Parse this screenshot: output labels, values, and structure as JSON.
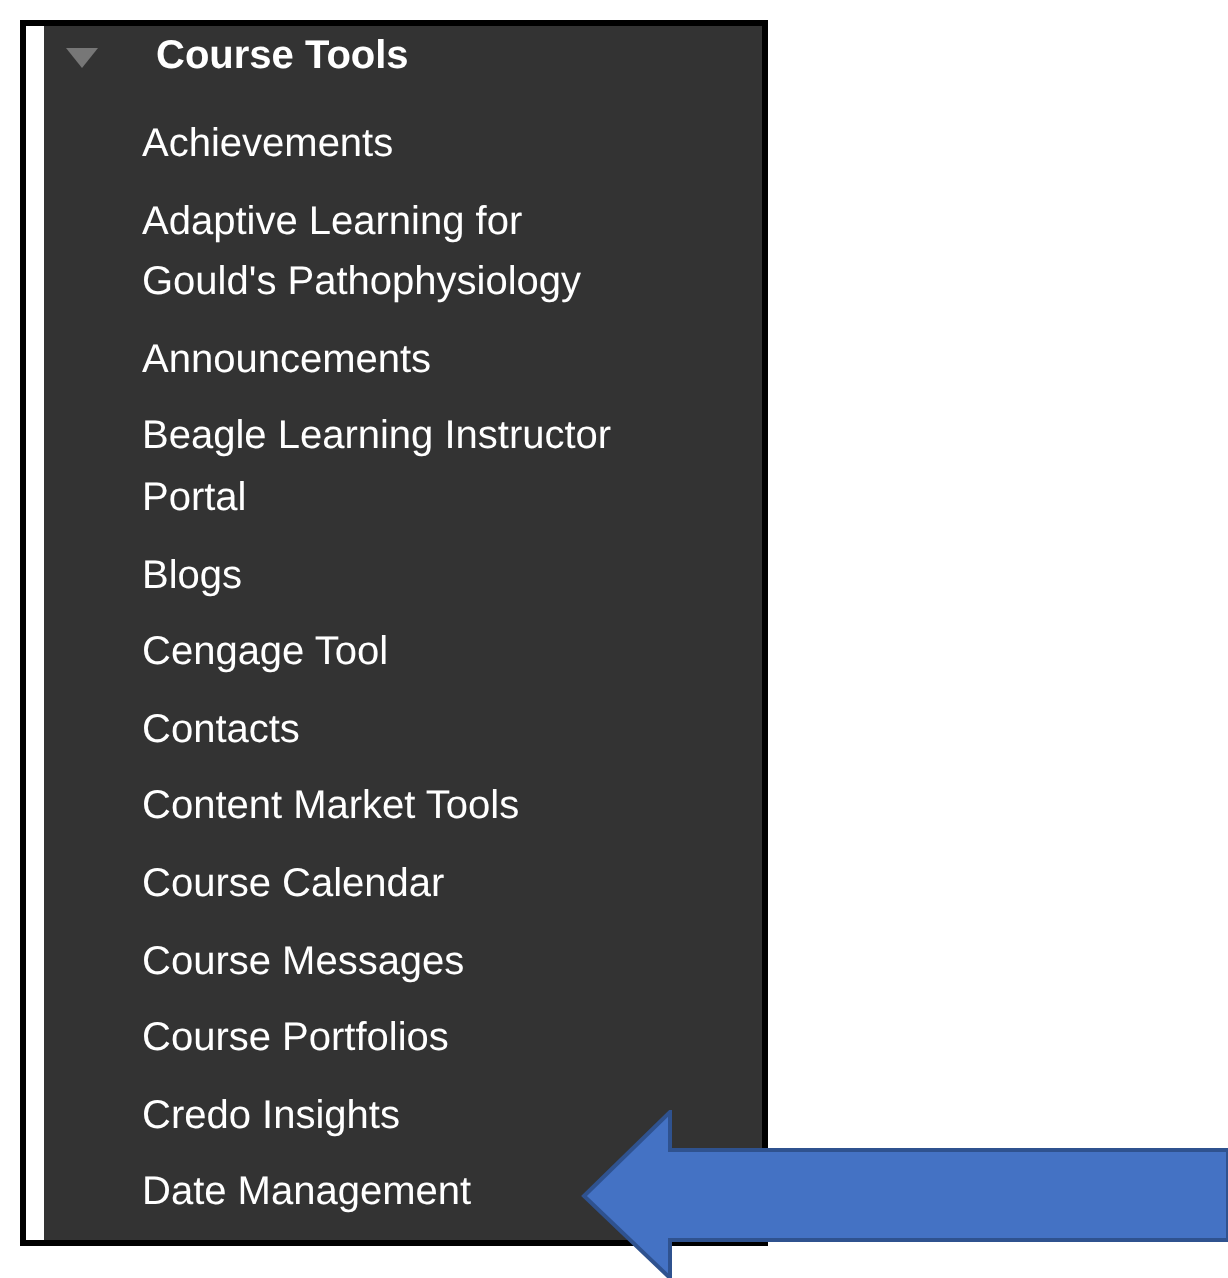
{
  "section": {
    "title": "Course Tools",
    "expanded": true
  },
  "items": [
    {
      "label": "Achievements"
    },
    {
      "label": "Adaptive Learning for Gould's Pathophysiology"
    },
    {
      "label": "Announcements"
    },
    {
      "label": "Beagle Learning Instructor Portal"
    },
    {
      "label": "Blogs"
    },
    {
      "label": "Cengage Tool"
    },
    {
      "label": "Contacts"
    },
    {
      "label": "Content Market Tools"
    },
    {
      "label": "Course Calendar"
    },
    {
      "label": "Course Messages"
    },
    {
      "label": "Course Portfolios"
    },
    {
      "label": "Credo Insights"
    },
    {
      "label": "Date Management"
    }
  ]
}
